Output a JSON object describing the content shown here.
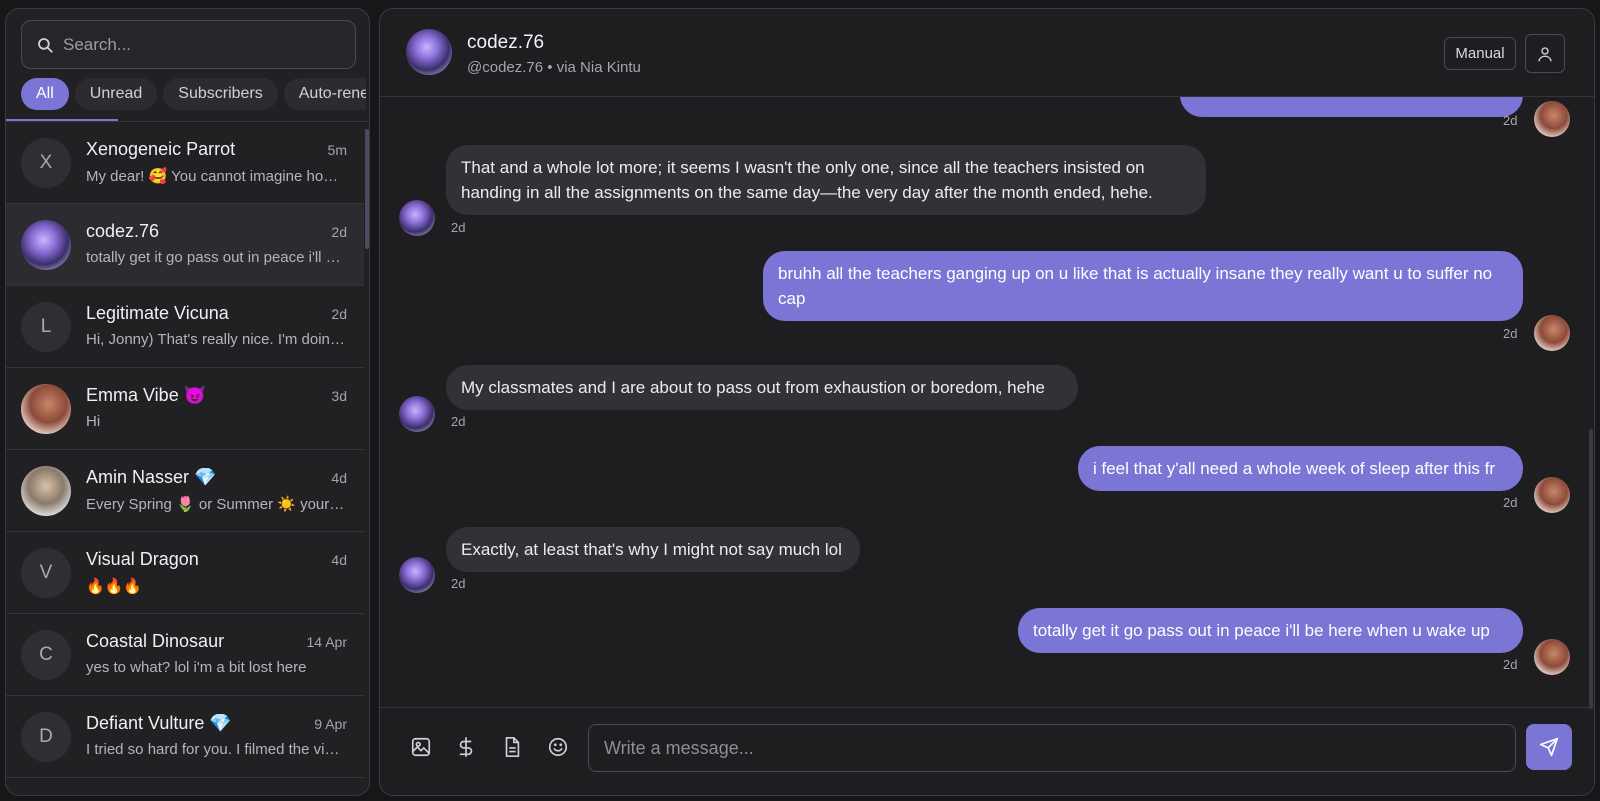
{
  "sidebar": {
    "search_placeholder": "Search...",
    "filters": [
      "All",
      "Unread",
      "Subscribers",
      "Auto-renew"
    ],
    "conversations": [
      {
        "initial": "X",
        "name": "Xenogeneic Parrot",
        "badge": "",
        "time": "5m",
        "preview": "My dear! 🥰 You cannot imagine how …"
      },
      {
        "initial": "",
        "name": "codez.76",
        "badge": "",
        "time": "2d",
        "preview": "totally get it go pass out in peace i'll b…"
      },
      {
        "initial": "L",
        "name": "Legitimate Vicuna",
        "badge": "",
        "time": "2d",
        "preview": "Hi, Jonny) That's really nice. I'm doing…"
      },
      {
        "initial": "",
        "name": "Emma Vibe",
        "badge": "😈",
        "time": "3d",
        "preview": "Hi"
      },
      {
        "initial": "",
        "name": "Amin Nasser",
        "badge": "💎",
        "time": "4d",
        "preview": "Every Spring 🌷 or Summer ☀️ your al…"
      },
      {
        "initial": "V",
        "name": "Visual Dragon",
        "badge": "",
        "time": "4d",
        "preview": "🔥🔥🔥"
      },
      {
        "initial": "C",
        "name": "Coastal Dinosaur",
        "badge": "",
        "time": "14 Apr",
        "preview": "yes to what? lol i'm a bit lost here"
      },
      {
        "initial": "D",
        "name": "Defiant Vulture",
        "badge": "💎",
        "time": "9 Apr",
        "preview": "I tried so hard for you. I filmed the vid…"
      }
    ]
  },
  "chat": {
    "name": "codez.76",
    "subtitle": "@codez.76 • via Nia Kintu",
    "mode_label": "Manual",
    "messages": [
      {
        "dir": "out",
        "text": "",
        "time": "2d"
      },
      {
        "dir": "in",
        "text": "That and a whole lot more; it seems I wasn't the only one, since all the teachers insisted on handing in all the assignments on the same day—the very day after the month ended, hehe.",
        "time": "2d"
      },
      {
        "dir": "out",
        "text": "bruhh all the teachers ganging up on u like that is actually insane they really want u to suffer no cap",
        "time": "2d"
      },
      {
        "dir": "in",
        "text": "My classmates and I are about to pass out from exhaustion or boredom, hehe",
        "time": "2d"
      },
      {
        "dir": "out",
        "text": "i feel that y'all need a whole week of sleep after this fr",
        "time": "2d"
      },
      {
        "dir": "in",
        "text": "Exactly, at least that's why I might not say much lol",
        "time": "2d"
      },
      {
        "dir": "out",
        "text": "totally get it go pass out in peace i'll be here when u wake up",
        "time": "2d"
      }
    ],
    "composer_placeholder": "Write a message..."
  },
  "colors": {
    "accent": "#7b76d6",
    "background": "#17171a",
    "panel": "#1e1e21",
    "incoming_bubble": "#323236"
  },
  "icons": [
    "search-icon",
    "user-icon",
    "image-icon",
    "dollar-icon",
    "document-icon",
    "emoji-icon",
    "send-icon"
  ]
}
